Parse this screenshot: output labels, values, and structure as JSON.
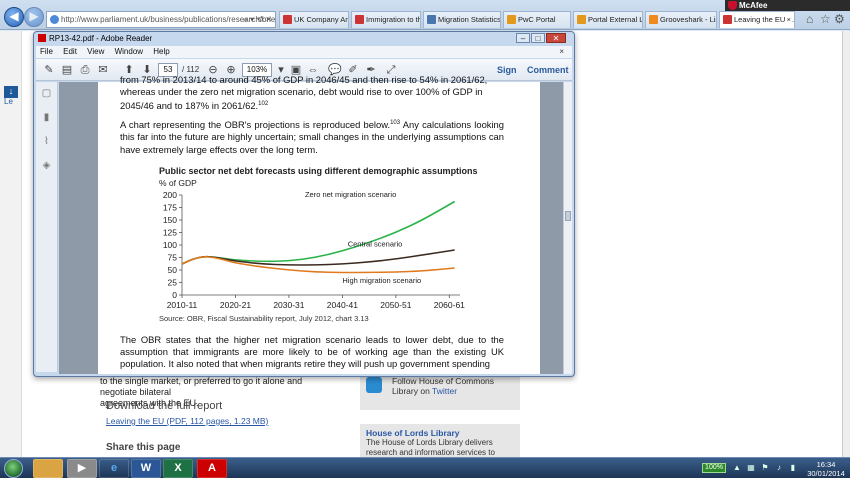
{
  "browser": {
    "address": "http://www.parliament.uk/business/publications/research/briefir",
    "address_tools": "⌕ ▾ ⟲ ✕",
    "tabs": [
      {
        "label": "UK Company Analy..."
      },
      {
        "label": "Immigration to the..."
      },
      {
        "label": "Migration Statistics..."
      },
      {
        "label": "PwC Portal"
      },
      {
        "label": "Portal External Link"
      },
      {
        "label": "Grooveshark - Liste..."
      },
      {
        "label": "Leaving the EU - ..."
      }
    ],
    "mcafee_label": "McAfee",
    "close_x": "×"
  },
  "reader": {
    "title": "RP13-42.pdf - Adobe Reader",
    "menu": [
      "File",
      "Edit",
      "View",
      "Window",
      "Help"
    ],
    "menu_close": "×",
    "page_current": "53",
    "page_total": "/ 112",
    "zoom": "103%",
    "sign": "Sign",
    "comment": "Comment"
  },
  "document": {
    "para_top_1": "from 75% in 2013/14 to around 45% of GDP in 2046/45 and then rise to 54% in 2061/62,",
    "para_top_2": "whereas under the zero net migration scenario, debt would rise to over 100% of GDP in",
    "para_top_3": "2045/46 and to 187% in 2061/62.",
    "fn_102": "102",
    "para_mid_a": "A chart representing the OBR's projections is reproduced below.",
    "fn_103": "103",
    "para_mid_b": " Any calculations looking this far into the future are highly uncertain; small changes in the underlying assumptions can have extremely large effects over the long term.",
    "para_bottom": "The OBR states that the higher net migration scenario leads to lower debt, due to the assumption that immigrants are more likely to be of working age than the existing UK population. It also noted that when migrants retire they will push up government spending"
  },
  "chart_data": {
    "type": "line",
    "title": "Public sector net debt forecasts using different demographic assumptions",
    "ylabel": "% of GDP",
    "source": "Source: OBR, Fiscal Sustainability report, July 2012, chart 3.13",
    "x_ticks": [
      "2010-11",
      "2020-21",
      "2030-31",
      "2040-41",
      "2050-51",
      "2060-61"
    ],
    "x_tick_years": [
      2010,
      2020,
      2030,
      2040,
      2050,
      2060
    ],
    "xlim": [
      2010,
      2062
    ],
    "ylim": [
      0,
      200
    ],
    "y_ticks": [
      0,
      25,
      50,
      75,
      100,
      125,
      150,
      175,
      200
    ],
    "grid": false,
    "series": [
      {
        "name": "Zero net migration scenario",
        "color": "#2bb34a",
        "x": [
          2010,
          2012,
          2014,
          2016,
          2018,
          2020,
          2025,
          2030,
          2035,
          2040,
          2045,
          2050,
          2055,
          2061
        ],
        "y": [
          62,
          72,
          77,
          76,
          73,
          70,
          67,
          68,
          75,
          88,
          105,
          125,
          150,
          187
        ]
      },
      {
        "name": "Central scenario",
        "color": "#3b2a20",
        "x": [
          2010,
          2012,
          2014,
          2016,
          2018,
          2020,
          2025,
          2030,
          2035,
          2040,
          2045,
          2050,
          2055,
          2061
        ],
        "y": [
          62,
          72,
          77,
          76,
          72,
          68,
          62,
          60,
          60,
          62,
          66,
          72,
          80,
          90
        ]
      },
      {
        "name": "High migration scenario",
        "color": "#e07a1e",
        "x": [
          2010,
          2012,
          2014,
          2016,
          2018,
          2020,
          2025,
          2030,
          2035,
          2040,
          2045,
          2050,
          2055,
          2061
        ],
        "y": [
          62,
          72,
          77,
          75,
          70,
          64,
          56,
          50,
          46,
          45,
          45,
          46,
          48,
          54
        ]
      }
    ]
  },
  "webpage": {
    "below_text_1": "to the single market, or preferred to go it alone and negotiate bilateral",
    "below_text_2": "agreements with the EU.",
    "download_head": "Download the full report",
    "download_link": "Leaving the EU (PDF, 112 pages, 1.23 MB)",
    "share_head": "Share this page",
    "follow_1": "Follow House of Commons",
    "follow_2": "Library on ",
    "follow_twitter": "Twitter",
    "lords_head": "House of Lords Library",
    "lords_text": "The House of Lords Library delivers research and information services to"
  },
  "taskbar": {
    "battery": "100%",
    "time": "16:34",
    "date": "30/01/2014"
  }
}
